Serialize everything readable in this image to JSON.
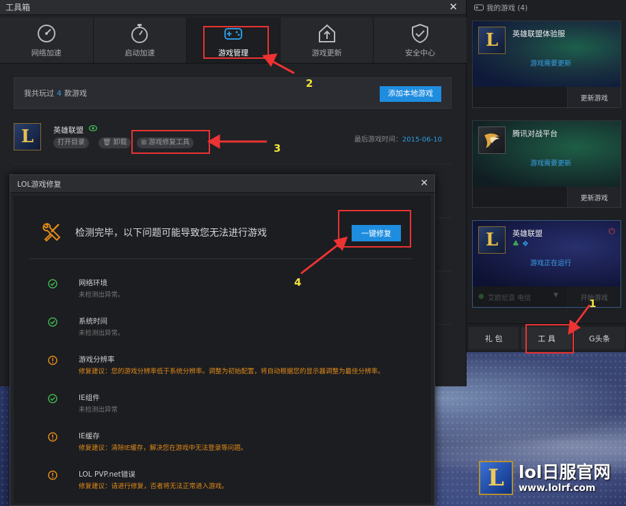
{
  "toolbox": {
    "title": "工具箱",
    "close": "✕",
    "tabs": [
      {
        "label": "网络加速",
        "icon": "speedometer-icon"
      },
      {
        "label": "启动加速",
        "icon": "stopwatch-icon"
      },
      {
        "label": "游戏管理",
        "icon": "gamepad-icon"
      },
      {
        "label": "游戏更新",
        "icon": "upload-house-icon"
      },
      {
        "label": "安全中心",
        "icon": "shield-check-icon"
      }
    ],
    "active_tab": "游戏管理",
    "summary": {
      "prefix": "我共玩过",
      "count": "4",
      "suffix": "款游戏"
    },
    "add_game_button": "添加本地游戏",
    "game": {
      "name": "英雄联盟",
      "logo_letter": "L",
      "open_dir": "打开目录",
      "uninstall": "卸载",
      "repair_tool": "游戏修复工具",
      "last_played_label": "最后游戏时间：",
      "last_played_date": "2015-06-10"
    }
  },
  "repair_dialog": {
    "title": "LOL游戏修复",
    "close": "✕",
    "headline": "检测完毕，以下问题可能导致您无法进行游戏",
    "fix_all_button": "一键修复",
    "items": [
      {
        "status": "ok",
        "title": "网络环境",
        "desc": "未检测出异常。"
      },
      {
        "status": "ok",
        "title": "系统时间",
        "desc": "未检测出异常。"
      },
      {
        "status": "warn",
        "title": "游戏分辨率",
        "desc": "修复建议：您的游戏分辨率低于系统分辨率。调整为初始配置，将自动根据您的显示器调整为最佳分辨率。"
      },
      {
        "status": "ok",
        "title": "IE组件",
        "desc": "未检测出异常"
      },
      {
        "status": "warn",
        "title": "IE缓存",
        "desc": "修复建议：清除IE缓存，解决您在游戏中无法登录等问题。"
      },
      {
        "status": "warn",
        "title": "LOL PVP.net错误",
        "desc": "修复建议：请进行修复，否者将无法正常进入游戏。"
      }
    ]
  },
  "right_panel": {
    "header": "我的游戏 (4)",
    "cards": [
      {
        "name": "英雄联盟体验服",
        "status": "游戏需要更新",
        "button": "更新游戏",
        "logo_letter": "L"
      },
      {
        "name": "腾讯对战平台",
        "status": "游戏需要更新",
        "button": "更新游戏",
        "logo_letter": ""
      },
      {
        "name": "英雄联盟",
        "status": "游戏正在运行",
        "button": "开始游戏",
        "logo_letter": "L",
        "server": "艾欧尼亚 电信"
      }
    ],
    "bottom_tabs": [
      "礼 包",
      "工 具",
      "G头条"
    ]
  },
  "annotations": [
    "1",
    "2",
    "3",
    "4"
  ],
  "watermark": {
    "title": "lol日服官网",
    "url": "www.lolrf.com",
    "logo_letter": "L"
  },
  "colors": {
    "accent": "#1e8de0",
    "warn": "#e28b17",
    "ok": "#3fb34f",
    "annotation_box": "#ee3333",
    "annotation_num": "#f2e33b"
  }
}
